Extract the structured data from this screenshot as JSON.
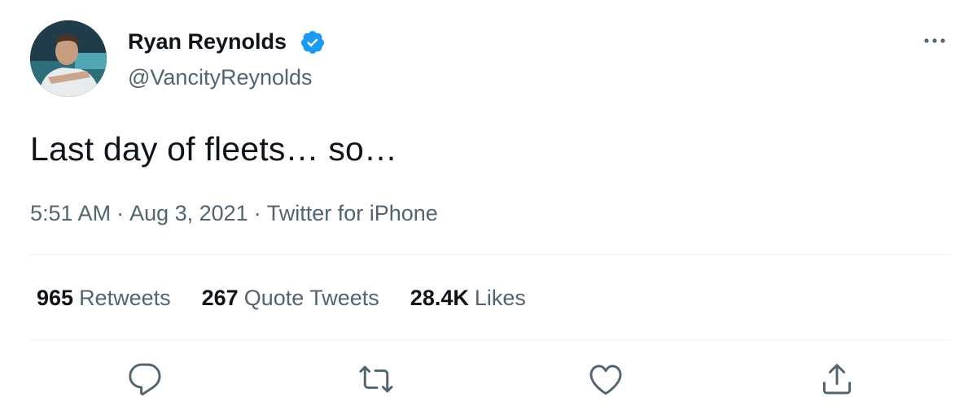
{
  "author": {
    "display_name": "Ryan Reynolds",
    "handle": "@VancityReynolds",
    "verified": true,
    "avatar_icon": "profile-photo"
  },
  "tweet": {
    "text": "Last day of fleets… so…",
    "time": "5:51 AM",
    "date": "Aug 3, 2021",
    "separator": "·",
    "source": "Twitter for iPhone"
  },
  "stats": {
    "retweets_count": "965",
    "retweets_label": "Retweets",
    "quotes_count": "267",
    "quotes_label": "Quote Tweets",
    "likes_count": "28.4K",
    "likes_label": "Likes"
  },
  "actions": {
    "icons": [
      "reply-icon",
      "retweet-icon",
      "like-icon",
      "share-icon"
    ]
  },
  "colors": {
    "verified_blue": "#1d9bf0",
    "secondary_text": "#536471",
    "primary_text": "#0f1419",
    "divider": "#eff3f4"
  }
}
